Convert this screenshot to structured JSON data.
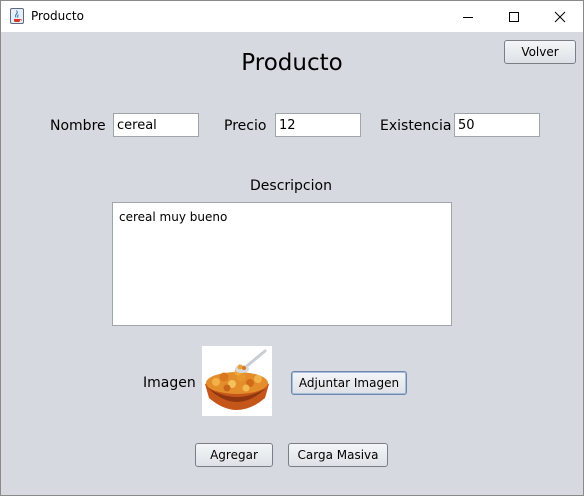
{
  "window": {
    "title": "Producto",
    "icon": "java-cup-icon",
    "controls": {
      "minimize": "minimize-icon",
      "maximize": "maximize-icon",
      "close": "close-icon"
    }
  },
  "header": {
    "heading": "Producto",
    "back_label": "Volver"
  },
  "form": {
    "name_label": "Nombre",
    "name_value": "cereal",
    "price_label": "Precio",
    "price_value": "12",
    "stock_label": "Existencia",
    "stock_value": "50",
    "description_label": "Descripcion",
    "description_value": "cereal muy bueno",
    "image_label": "Imagen",
    "attach_label": "Adjuntar Imagen"
  },
  "actions": {
    "add_label": "Agregar",
    "bulk_label": "Carga Masiva"
  }
}
